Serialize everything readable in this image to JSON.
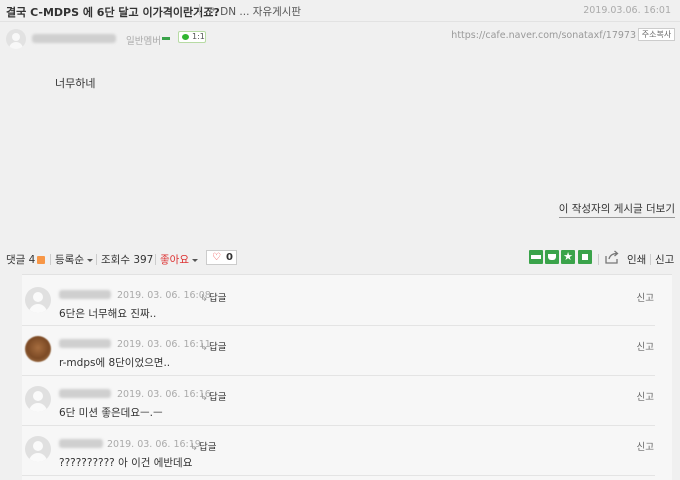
{
  "header": {
    "title": "결국 C-MDPS 에 6단 달고 이가격이란거죠?",
    "board": "DN ... 자유게시판",
    "date": "2019.03.06. 16:01"
  },
  "author": {
    "level": "일반멤버",
    "chat_badge": "1:1",
    "url": "https://cafe.naver.com/sonataxf/17973",
    "copy_url_label": "주소복사"
  },
  "post": {
    "body": "너무하네",
    "more_posts_label": "이 작성자의 게시글 더보기"
  },
  "toolbar": {
    "comment_label": "댓글 4",
    "sort_label": "등록순",
    "views_label": "조회수 397",
    "like_label": "좋아요",
    "heart_count": "0",
    "print_label": "인쇄",
    "report_label": "신고"
  },
  "colors": {
    "accent_green": "#3aa34a",
    "like_red": "#dd3333",
    "comment_badge": "#f79646"
  },
  "comments": [
    {
      "date": "2019. 03. 06. 16:08",
      "reply_label": "답글",
      "report_label": "신고",
      "text": "6단은 너무해요 진짜..",
      "avatar": "default"
    },
    {
      "date": "2019. 03. 06. 16:11",
      "reply_label": "답글",
      "report_label": "신고",
      "text": "r-mdps에 8단이었으면..",
      "avatar": "photo"
    },
    {
      "date": "2019. 03. 06. 16:16",
      "reply_label": "답글",
      "report_label": "신고",
      "text": "6단 미션 좋은데요ㅡ.ㅡ",
      "avatar": "default"
    },
    {
      "date": "2019. 03. 06. 16:19",
      "reply_label": "답글",
      "report_label": "신고",
      "text": "?????????? 아 이건 에반데요",
      "avatar": "default"
    }
  ]
}
